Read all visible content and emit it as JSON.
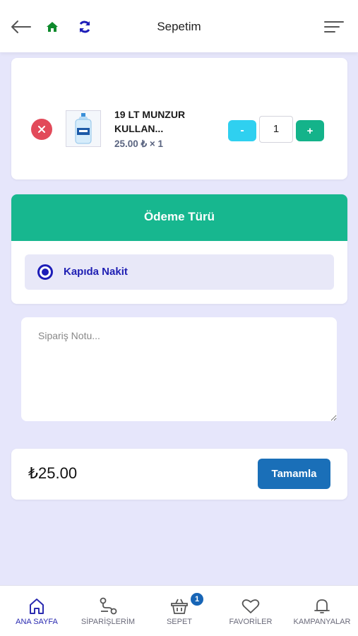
{
  "header": {
    "title": "Sepetim",
    "icons": {
      "back": "arrow-left-icon",
      "home": "home-icon",
      "refresh": "refresh-icon",
      "menu": "menu-icon"
    }
  },
  "cart": {
    "items": [
      {
        "name": "19 LT MUNZUR KULLAN...",
        "price_line": "25.00 ₺ × 1",
        "quantity": "1",
        "minus_label": "-",
        "plus_label": "+"
      }
    ]
  },
  "payment": {
    "title": "Ödeme Türü",
    "option_label": "Kapıda Nakit",
    "selected": true
  },
  "note": {
    "placeholder": "Sipariş Notu...",
    "value": ""
  },
  "summary": {
    "total": "₺25.00",
    "complete_label": "Tamamla"
  },
  "bottom_nav": {
    "items": [
      {
        "label": "ANA SAYFA",
        "icon": "home-outline-icon",
        "active": true
      },
      {
        "label": "SİPARİŞLERİM",
        "icon": "route-icon",
        "active": false
      },
      {
        "label": "SEPET",
        "icon": "basket-icon",
        "active": false,
        "badge": "1"
      },
      {
        "label": "FAVORİLER",
        "icon": "heart-icon",
        "active": false
      },
      {
        "label": "KAMPANYALAR",
        "icon": "bell-icon",
        "active": false
      }
    ]
  },
  "colors": {
    "background": "#e6e6fb",
    "green_header": "#17b78f",
    "minus_button": "#2fd0f0",
    "plus_button": "#14b38a",
    "remove_button": "#e24a5a",
    "complete_button": "#1a6fb8",
    "payment_accent": "#1d1db8",
    "nav_active": "#2a2ab0"
  }
}
